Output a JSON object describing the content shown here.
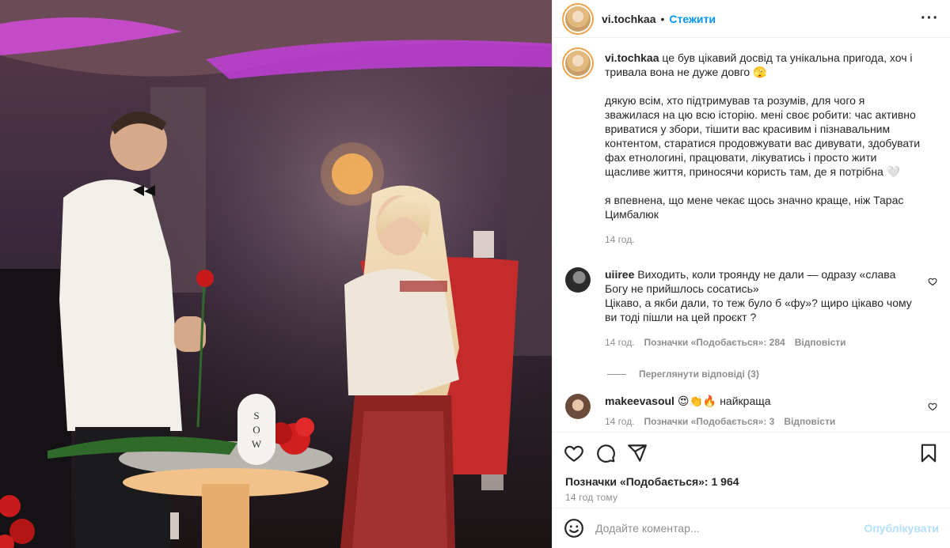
{
  "header": {
    "username": "vi.tochkaa",
    "follow_label": "Стежити",
    "more_icon": "more-icon"
  },
  "caption": {
    "username": "vi.tochkaa",
    "text_1": "це був цікавий досвід та унікальна пригода, хоч і тривала вона не дуже довго 🫣",
    "text_2": "дякую всім, хто підтримував та розумів, для чого я зважилася на цю всю історію. мені своє робити: час активно вриватися у збори, тішити вас красивим і пізнавальним контентом, старатися продовжувати вас дивувати, здобувати фах етнологині, працювати, лікуватись і просто жити щасливе життя, приносячи користь там, де я потрібна 🤍",
    "text_3": "я впевнена, що мене чекає щось значно краще, ніж Тарас Цимбалюк",
    "time": "14 год."
  },
  "comments": [
    {
      "username": "uiiree",
      "text": "Виходить, коли троянду не дали — одразу «слава Богу не прийшлось сосатись»\nЦікаво, а якби дали, то теж було б «фу»? щиро цікаво чому ви тоді пішли на цей проєкт ?",
      "time": "14 год.",
      "likes": "Позначки «Подобається»: 284",
      "reply": "Відповісти",
      "view_replies": "Переглянути відповіді (3)"
    },
    {
      "username": "makeevasoul",
      "text": "😍👏🔥 найкраща",
      "time": "14 год.",
      "likes": "Позначки «Подобається»: 3",
      "reply": "Відповісти"
    }
  ],
  "likes_total": "Позначки «Подобається»: 1 964",
  "posted_ago": "14 год тому",
  "add_comment": {
    "placeholder": "Додайте коментар...",
    "post_label": "Опублікувати"
  },
  "colors": {
    "accent": "#0095f6",
    "muted": "#8e8e8e",
    "post_disabled": "#b2dffc"
  }
}
